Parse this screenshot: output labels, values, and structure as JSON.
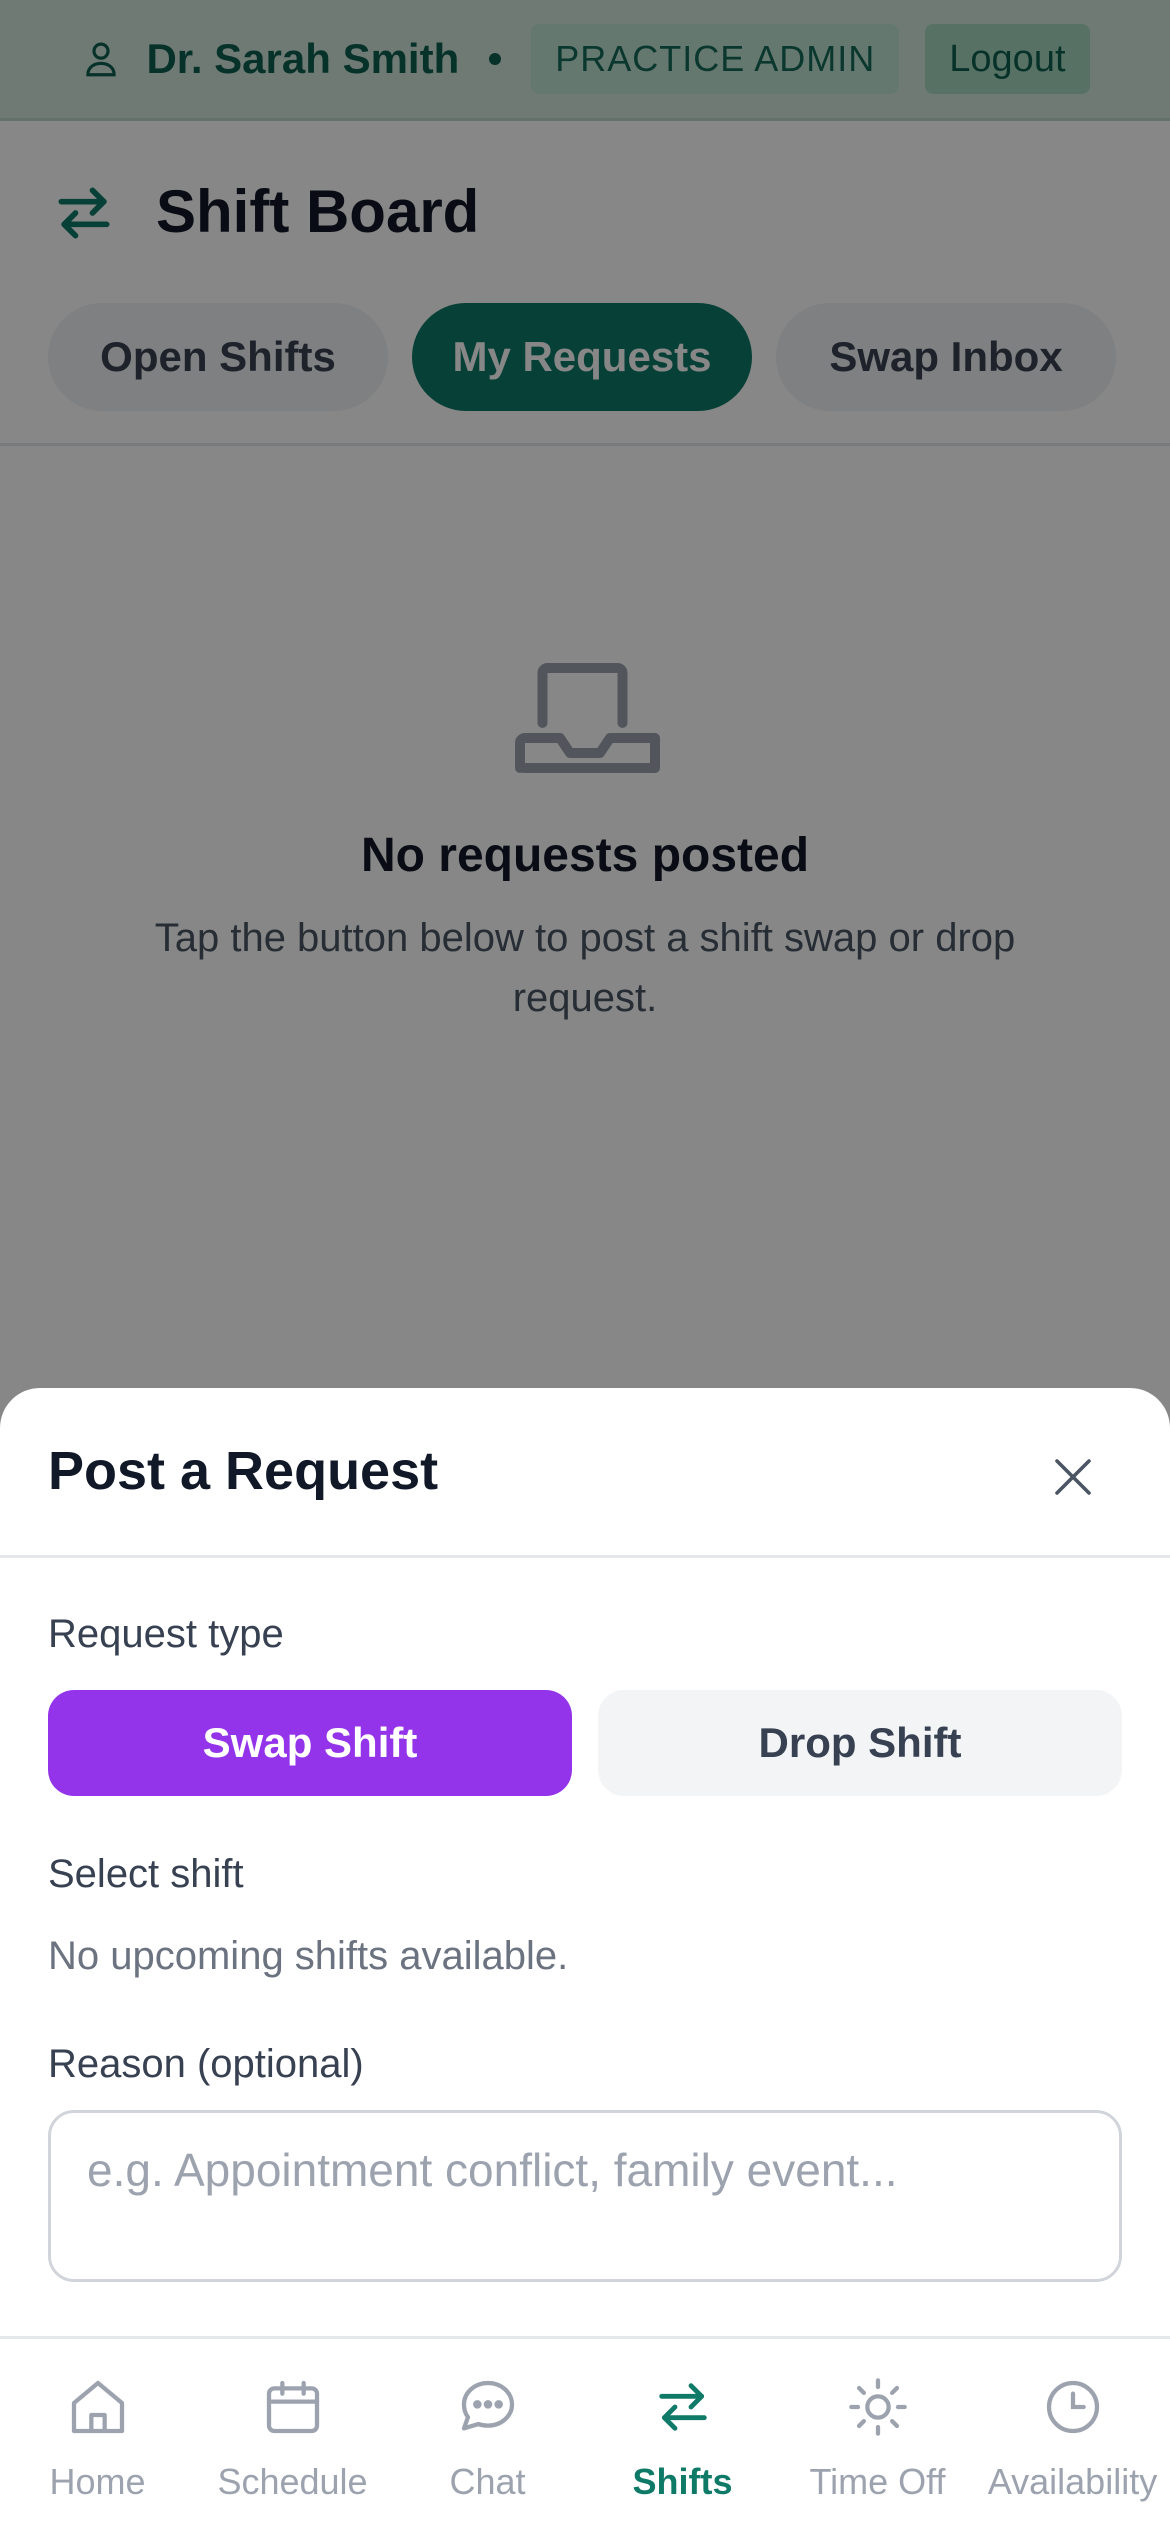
{
  "user_bar": {
    "name": "Dr. Sarah Smith",
    "role": "PRACTICE ADMIN",
    "logout_label": "Logout"
  },
  "header": {
    "title": "Shift Board",
    "tabs": [
      {
        "label": "Open Shifts",
        "active": false
      },
      {
        "label": "My Requests",
        "active": true
      },
      {
        "label": "Swap Inbox",
        "active": false
      }
    ]
  },
  "empty_state": {
    "title": "No requests posted",
    "text": "Tap the button below to post a shift swap or drop request."
  },
  "sheet": {
    "title": "Post a Request",
    "request_type_label": "Request type",
    "swap_label": "Swap Shift",
    "drop_label": "Drop Shift",
    "selected_type": "Swap Shift",
    "select_shift_label": "Select shift",
    "no_shifts_text": "No upcoming shifts available.",
    "reason_label": "Reason (optional)",
    "reason_placeholder": "e.g. Appointment conflict, family event...",
    "reason_value": ""
  },
  "bottom_nav": {
    "items": [
      {
        "label": "Home",
        "icon": "home-icon",
        "active": false
      },
      {
        "label": "Schedule",
        "icon": "calendar-icon",
        "active": false
      },
      {
        "label": "Chat",
        "icon": "chat-icon",
        "active": false
      },
      {
        "label": "Shifts",
        "icon": "swap-arrows-icon",
        "active": true
      },
      {
        "label": "Time Off",
        "icon": "sun-icon",
        "active": false
      },
      {
        "label": "Availability",
        "icon": "clock-icon",
        "active": false
      }
    ]
  },
  "colors": {
    "primary_teal": "#0f7a67",
    "accent_purple": "#9333ea",
    "overlay": "rgba(0,0,0,0.47)"
  }
}
